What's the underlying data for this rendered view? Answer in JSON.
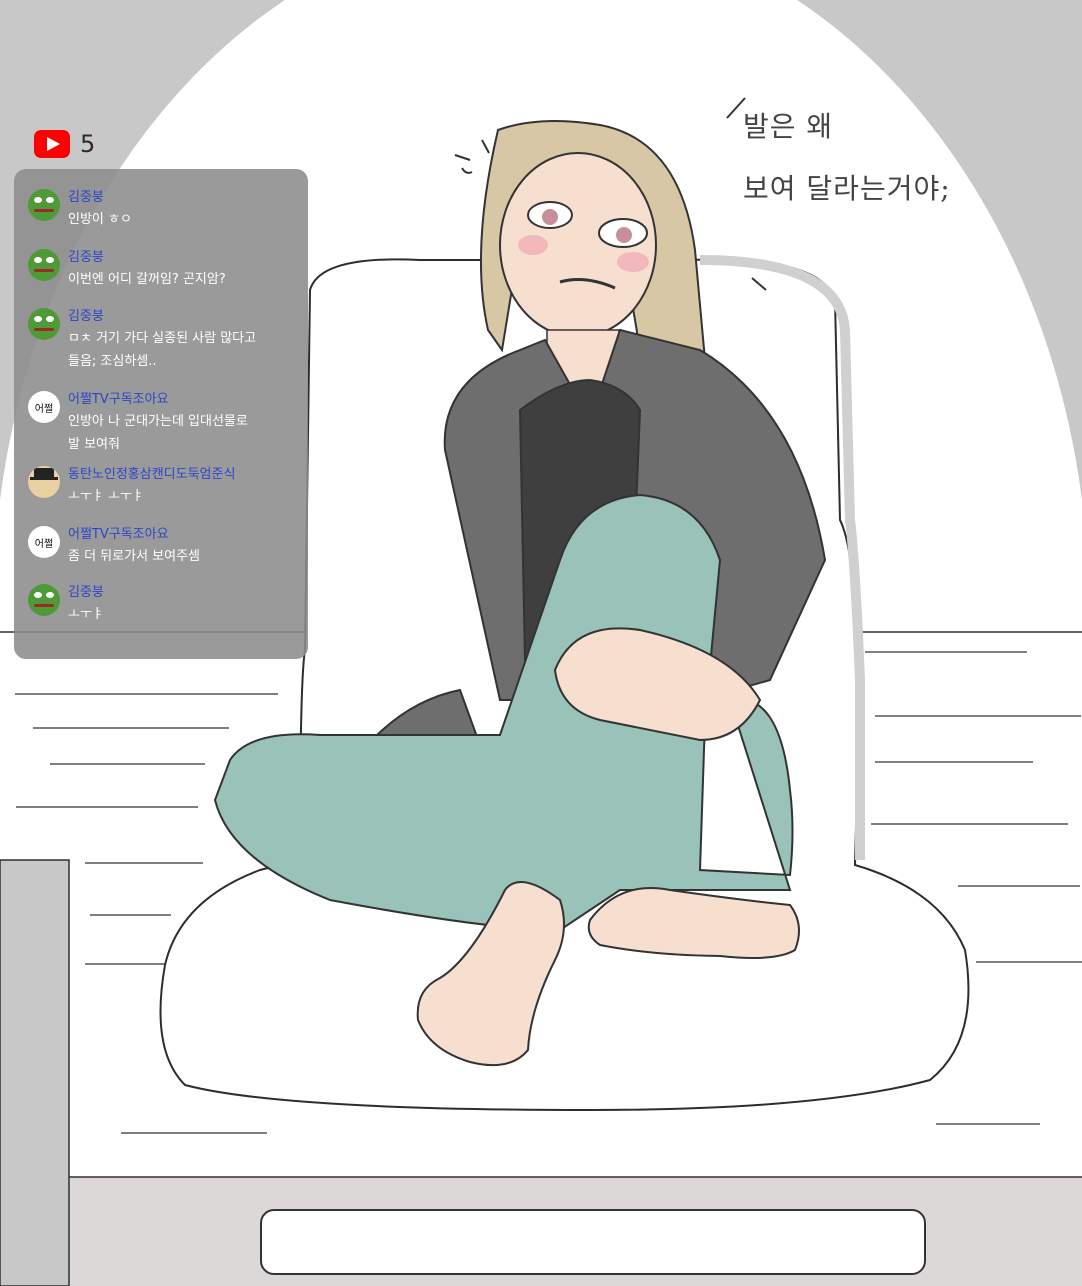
{
  "viewer": {
    "count": "5",
    "icon": "youtube-play-icon"
  },
  "chat": [
    {
      "name": "김중붕",
      "avatar": "pepe-avatar",
      "lines": [
        "인방이 ㅎㅇ"
      ]
    },
    {
      "name": "김중붕",
      "avatar": "pepe-avatar",
      "lines": [
        "이번엔 어디 갈꺼임? 곤지암?"
      ]
    },
    {
      "name": "김중붕",
      "avatar": "pepe-avatar",
      "lines": [
        "ㅁㅊ 거기 가다 실종된 사람 많다고",
        "들음; 조심하셈.."
      ]
    },
    {
      "name": "어쩔TV구독조아요",
      "avatar": "text-avatar",
      "avatar_text": "어쩔",
      "lines": [
        "인방아 나 군대가는데 입대선물로",
        "발 보여줘"
      ]
    },
    {
      "name": "동탄노인정홍삼캔디도둑엄준식",
      "avatar": "hat-avatar",
      "lines": [
        "ㅗㅜㅑ ㅗㅜㅑ"
      ]
    },
    {
      "name": "어쩔TV구독조아요",
      "avatar": "text-avatar",
      "avatar_text": "어쩔",
      "lines": [
        "좀 더 뒤로가서 보여주셈"
      ]
    },
    {
      "name": "김중붕",
      "avatar": "pepe-avatar",
      "lines": [
        "ㅗㅜㅑ"
      ]
    }
  ],
  "speech": {
    "line1": "발은 왜",
    "line2": "보여 달라는거야;"
  },
  "colors": {
    "hair": "#d8c7a4",
    "hoodie": "#6e6e6e",
    "pants": "#99c2b9",
    "skin": "#f7dfcf",
    "floor": "#dcd8d8"
  }
}
